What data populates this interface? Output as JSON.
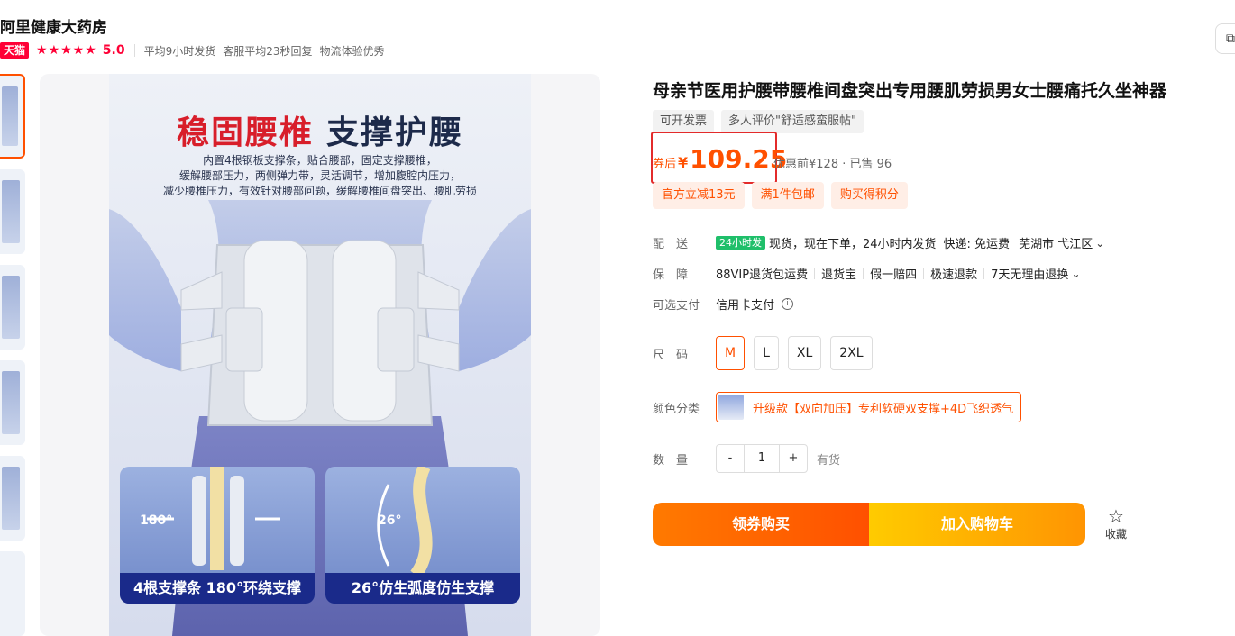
{
  "store": {
    "name": "阿里健康大药房",
    "badge": "天猫",
    "stars": "★★★★★",
    "rating": "5.0",
    "metrics": [
      "平均9小时发货",
      "客服平均23秒回复",
      "物流体验优秀"
    ]
  },
  "hero": {
    "title_red": "稳固腰椎",
    "title_dark": "支撑护腰",
    "desc": [
      "内置4根钢板支撑条，贴合腰部，固定支撑腰椎，",
      "缓解腰部压力，两侧弹力带，灵活调节，增加腹腔内压力，",
      "减少腰椎压力，有效针对腰部问题，缓解腰椎间盘突出、腰肌劳损"
    ],
    "panels": [
      {
        "angle": "180°",
        "caption": "4根支撑条 180°环绕支撑"
      },
      {
        "angle": "26°",
        "caption": "26°仿生弧度仿生支撑"
      }
    ]
  },
  "product": {
    "title": "母亲节医用护腰带腰椎间盘突出专用腰肌劳损男女士腰痛托久坐神器",
    "tags": [
      "可开发票",
      "多人评价\"舒适感蛮服帖\""
    ],
    "price_prefix": "券后",
    "currency": "¥",
    "price": "109.25",
    "price_extra": "优惠前¥128 · 已售 96",
    "promos": [
      "官方立减13元",
      "满1件包邮",
      "购买得积分"
    ]
  },
  "delivery": {
    "label": "配　送",
    "badge": "24小时发",
    "text": "现货，现在下单，24小时内发货",
    "shipping": "快递: 免运费",
    "location": "芜湖市 弋江区"
  },
  "guarantee": {
    "label": "保　障",
    "items": [
      "88VIP退货包运费",
      "退货宝",
      "假一赔四",
      "极速退款",
      "7天无理由退换"
    ]
  },
  "payment": {
    "label": "可选支付",
    "value": "信用卡支付"
  },
  "size": {
    "label": "尺　码",
    "options": [
      "M",
      "L",
      "XL",
      "2XL"
    ],
    "selected": "M"
  },
  "color": {
    "label": "颜色分类",
    "option": "升级款【双向加压】专利软硬双支撑+4D飞织透气"
  },
  "quantity": {
    "label": "数　量",
    "minus": "-",
    "value": "1",
    "plus": "+",
    "stock": "有货"
  },
  "actions": {
    "buy": "领券购买",
    "cart": "加入购物车",
    "favorite": "收藏"
  },
  "colors": {
    "accent": "#ff5000",
    "tmall": "#ff0036",
    "price_box": "#e32b2b"
  }
}
